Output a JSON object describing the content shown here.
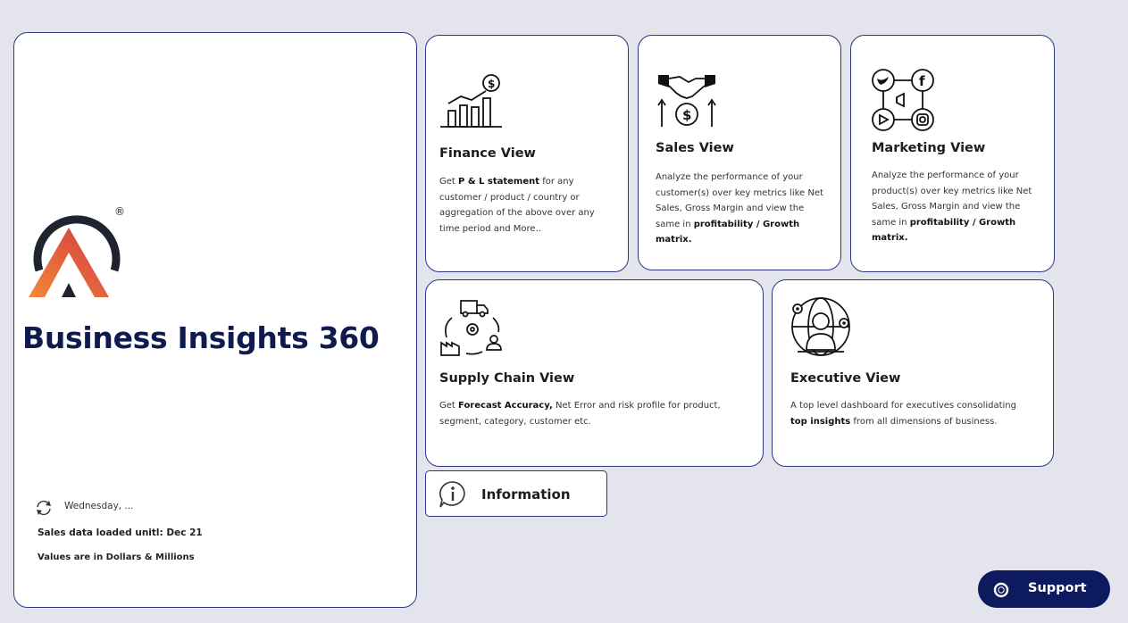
{
  "landing": {
    "app_title": "Business Insights 360",
    "refresh_date": "Wednesday, ...",
    "sales_note": "Sales data loaded unitl: Dec 21",
    "values_note": "Values are in Dollars & Millions",
    "logo_mark": "®"
  },
  "finance": {
    "title": "Finance View",
    "desc_pre": "Get ",
    "desc_bold": "P & L statement",
    "desc_post": " for any customer / product / country or aggregation of the above over any time period and More..",
    "icon": "finance-chart-icon"
  },
  "sales": {
    "title": "Sales View",
    "desc_pre": "Analyze the performance of your customer(s) over key metrics like Net Sales, Gross Margin and view the same in ",
    "desc_bold": "profitability / Growth matrix.",
    "icon": "handshake-dollar-icon"
  },
  "marketing": {
    "title": "Marketing View",
    "desc_pre": "Analyze the performance of your product(s) over key metrics like Net Sales, Gross Margin and view the same in ",
    "desc_bold": "profitability / Growth matrix.",
    "icon": "social-media-icon"
  },
  "supply_chain": {
    "title": "Supply Chain View",
    "desc_pre": "Get ",
    "desc_bold": "Forecast Accuracy,",
    "desc_post": " Net Error and risk profile for product, segment, category, customer etc.",
    "icon": "supply-chain-icon"
  },
  "executive": {
    "title": "Executive View",
    "desc_pre": "A top level dashboard for executives consolidating ",
    "desc_bold": "top insights",
    "desc_post": " from all dimensions of business.",
    "icon": "executive-globe-icon"
  },
  "info": {
    "label": "Information",
    "icon": "info-icon"
  },
  "support": {
    "label": "Support",
    "icon": "support-icon"
  },
  "colors": {
    "page_bg": "#e4e5ec",
    "card_border": "#2e3584",
    "title_navy": "#0f1a4f",
    "support_bg": "#0d1a5e",
    "logo_orange": "#f07b3a",
    "logo_red": "#d6383f",
    "logo_dark": "#1f2330"
  }
}
